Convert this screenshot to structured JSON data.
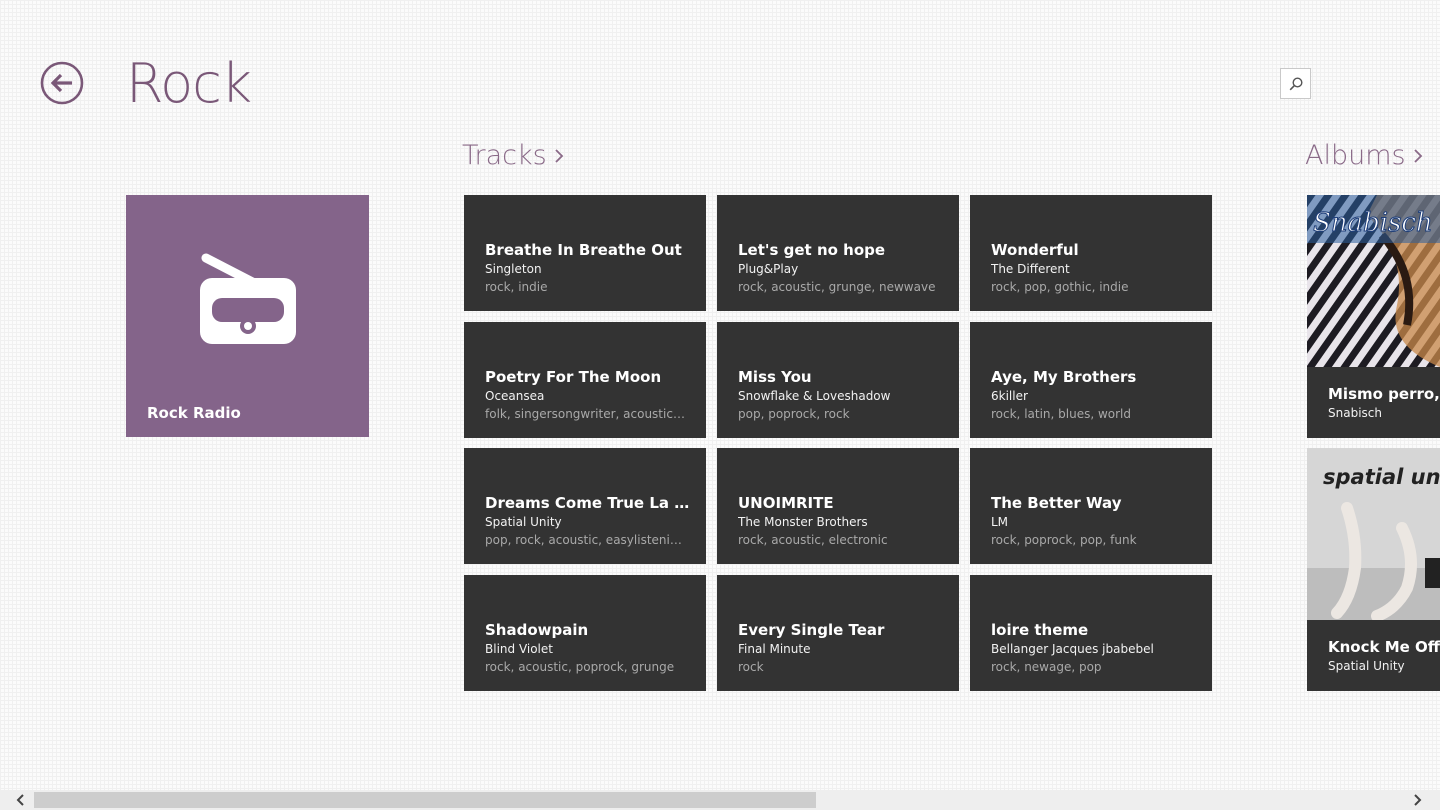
{
  "header": {
    "title": "Rock",
    "back_icon": "back-arrow-icon",
    "search_icon": "search-icon"
  },
  "colors": {
    "accent": "#7a5878",
    "radio_tile": "#84648a",
    "tile_bg": "#333333"
  },
  "radio": {
    "label": "Rock Radio",
    "icon": "radio-icon"
  },
  "tracks_section": {
    "label": "Tracks",
    "items": [
      {
        "title": "Breathe In Breathe Out",
        "artist": "Singleton",
        "tags": "rock, indie"
      },
      {
        "title": "Let's get no hope",
        "artist": "Plug&Play",
        "tags": "rock, acoustic, grunge, newwave"
      },
      {
        "title": "Wonderful",
        "artist": "The Different",
        "tags": "rock, pop, gothic, indie"
      },
      {
        "title": "Poetry For The Moon",
        "artist": "Oceansea",
        "tags": "folk, singersongwriter, acoustic,..."
      },
      {
        "title": "Miss You",
        "artist": "Snowflake & Loveshadow",
        "tags": "pop, poprock, rock"
      },
      {
        "title": "Aye, My Brothers",
        "artist": "6killer",
        "tags": "rock, latin, blues, world"
      },
      {
        "title": "Dreams Come True La Ac...",
        "artist": "Spatial Unity",
        "tags": "pop, rock, acoustic, easylistening"
      },
      {
        "title": "UNOIMRITE",
        "artist": "The Monster Brothers",
        "tags": "rock, acoustic, electronic"
      },
      {
        "title": "The Better Way",
        "artist": "LM",
        "tags": "rock, poprock, pop, funk"
      },
      {
        "title": "Shadowpain",
        "artist": "Blind Violet",
        "tags": "rock, acoustic, poprock, grunge"
      },
      {
        "title": "Every Single Tear",
        "artist": "Final Minute",
        "tags": "rock"
      },
      {
        "title": "loire theme",
        "artist": "Bellanger Jacques jbabebel",
        "tags": "rock, newage, pop"
      }
    ]
  },
  "albums_section": {
    "label": "Albums",
    "items": [
      {
        "title": "Mismo perro, d",
        "artist": "Snabisch",
        "art_text": "Snabisch"
      },
      {
        "title": "Knock Me Off M",
        "artist": "Spatial Unity",
        "art_text": "spatial unity"
      }
    ]
  },
  "scrollbar": {
    "left_icon": "chevron-left-icon",
    "right_icon": "chevron-right-icon"
  }
}
